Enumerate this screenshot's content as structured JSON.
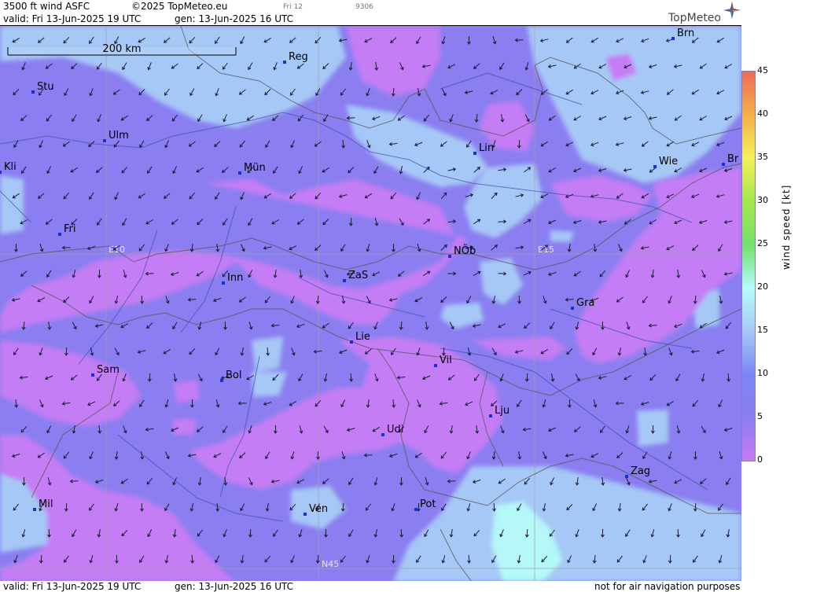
{
  "header": {
    "product": "3500 ft wind ASFC",
    "copyright": "©2025 TopMeteo.eu",
    "day_code": "Fri 12",
    "code_num": "9306",
    "valid": "valid:  Fri  13-Jun-2025  19 UTC",
    "generated": "gen: 13-Jun-2025 16 UTC"
  },
  "logo": {
    "text": "TopMeteo"
  },
  "footer": {
    "valid": "valid:  Fri  13-Jun-2025  19 UTC",
    "generated": "gen: 13-Jun-2025 16 UTC",
    "disclaimer": "not for air navigation purposes"
  },
  "scale_bar": {
    "label": "200 km"
  },
  "grid_labels": {
    "e10": "E10",
    "e15": "E15",
    "n45": "N45"
  },
  "legend": {
    "title": "wind  speed  [kt]",
    "ticks": [
      "45",
      "40",
      "35",
      "30",
      "25",
      "20",
      "15",
      "10",
      "5",
      "0"
    ],
    "colors": {
      "0": "#c77cf5",
      "5": "#8c7cf0",
      "10": "#7b86f2",
      "15": "#a7c8f7",
      "20": "#b6fbfb",
      "25": "#72e06b",
      "30": "#a4e84e",
      "35": "#f5f05c",
      "40": "#f5b04a",
      "45": "#ee6b5a"
    }
  },
  "cities": [
    {
      "name": "Reg"
    },
    {
      "name": "Brn"
    },
    {
      "name": "Stu"
    },
    {
      "name": "Ulm"
    },
    {
      "name": "Lin"
    },
    {
      "name": "Kli"
    },
    {
      "name": "Mün"
    },
    {
      "name": "Wie"
    },
    {
      "name": "Br"
    },
    {
      "name": "Fri"
    },
    {
      "name": "NÖb"
    },
    {
      "name": "Inn"
    },
    {
      "name": "ZaS"
    },
    {
      "name": "Gra"
    },
    {
      "name": "Lie"
    },
    {
      "name": "Vil"
    },
    {
      "name": "Sam"
    },
    {
      "name": "Bol"
    },
    {
      "name": "Lju"
    },
    {
      "name": "Udi"
    },
    {
      "name": "Zag"
    },
    {
      "name": "Mil"
    },
    {
      "name": "Pot"
    },
    {
      "name": "Ven"
    }
  ]
}
